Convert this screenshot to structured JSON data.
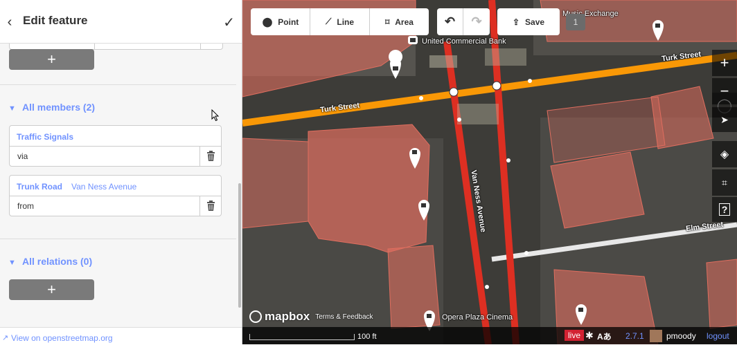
{
  "sidebar": {
    "title": "Edit feature",
    "add_label": "+",
    "members_title": "All members (2)",
    "members": [
      {
        "type": "Traffic Signals",
        "name": "",
        "role": "via"
      },
      {
        "type": "Trunk Road",
        "name": "Van Ness Avenue",
        "role": "from"
      }
    ],
    "relations_title": "All relations (0)",
    "footer_link": "View on openstreetmap.org"
  },
  "toolbar": {
    "point": "Point",
    "line": "Line",
    "area": "Area",
    "save": "Save",
    "save_count": "1"
  },
  "map": {
    "labels": {
      "bank": "United Commercial Bank",
      "music": "Music Exchange",
      "turk1": "Turk Street",
      "turk2": "Turk Street",
      "van_ness": "Van Ness Avenue",
      "elm": "Elm Street",
      "cinema": "Opera Plaza Cinema"
    },
    "attribution_logo": "mapbox",
    "attribution_link": "Terms & Feedback",
    "scale": "100 ft",
    "live": "live",
    "lang_glyph": "Aあ",
    "version": "2.7.1",
    "user": "pmoody",
    "logout": "logout"
  },
  "colors": {
    "accent": "#7092ff",
    "road_trunk": "#dd2f22",
    "road_secondary": "#f99806",
    "building": "#e06e5f"
  }
}
